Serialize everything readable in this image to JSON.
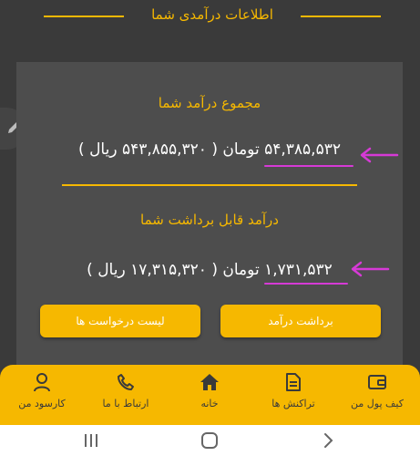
{
  "header": {
    "title": "اطلاعات درآمدی شما"
  },
  "total": {
    "title": "مجموع درآمد شما",
    "toman": "۵۴,۳۸۵,۵۳۲",
    "toman_unit": "تومان",
    "rial": "( ۵۴۳,۸۵۵,۳۲۰ ریال )"
  },
  "withdrawable": {
    "title": "درآمد قابل برداشت شما",
    "toman": "۱,۷۳۱,۵۳۲",
    "toman_unit": "تومان",
    "rial": "( ۱۷,۳۱۵,۳۲۰ ریال )"
  },
  "buttons": {
    "withdraw": "برداشت درآمد",
    "requests_list": "لیست درخواست ها"
  },
  "bottom_nav": {
    "wallet": "کیف پول من",
    "transactions": "تراکنش ها",
    "home": "خانه",
    "contact": "ارتباط با ما",
    "profile": "کارسود من"
  },
  "colors": {
    "accent": "#f6b800",
    "background": "#3a3a3a",
    "card": "#4d4d4d",
    "annotation": "#d63ad6"
  }
}
